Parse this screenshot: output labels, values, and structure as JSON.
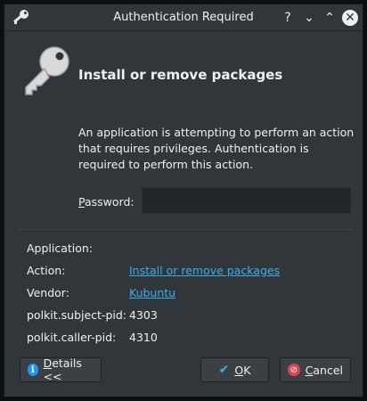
{
  "window": {
    "title": "Authentication Required",
    "help_glyph": "?",
    "minimize_glyph": "⌄",
    "maximize_glyph": "⌃",
    "close_glyph": "✕"
  },
  "dialog": {
    "heading": "Install or remove packages",
    "description": "An application is attempting to perform an action that requires privileges. Authentication is required to perform this action.",
    "password_label_mnemonic": "P",
    "password_label_rest": "assword:",
    "password_value": ""
  },
  "details": [
    {
      "label": "Application:",
      "value": "",
      "link": false
    },
    {
      "label": "Action:",
      "value": "Install or remove packages",
      "link": true
    },
    {
      "label": "Vendor:",
      "value": "Kubuntu",
      "link": true
    },
    {
      "label": "polkit.subject-pid:",
      "value": "4303",
      "link": false
    },
    {
      "label": "polkit.caller-pid:",
      "value": "4310",
      "link": false
    }
  ],
  "buttons": {
    "details_mnemonic": "D",
    "details_rest": "etails <<",
    "ok_mnemonic": "O",
    "ok_rest": "K",
    "cancel_mnemonic": "C",
    "cancel_rest": "ancel"
  },
  "icons": {
    "title_icon": "key-icon",
    "dialog_icon": "key-icon",
    "details_icon": "info-icon",
    "ok_icon": "checkmark-icon",
    "cancel_icon": "cancel-icon"
  },
  "colors": {
    "window_bg": "#31363b",
    "link": "#3daee9",
    "input_bg": "#232629"
  }
}
